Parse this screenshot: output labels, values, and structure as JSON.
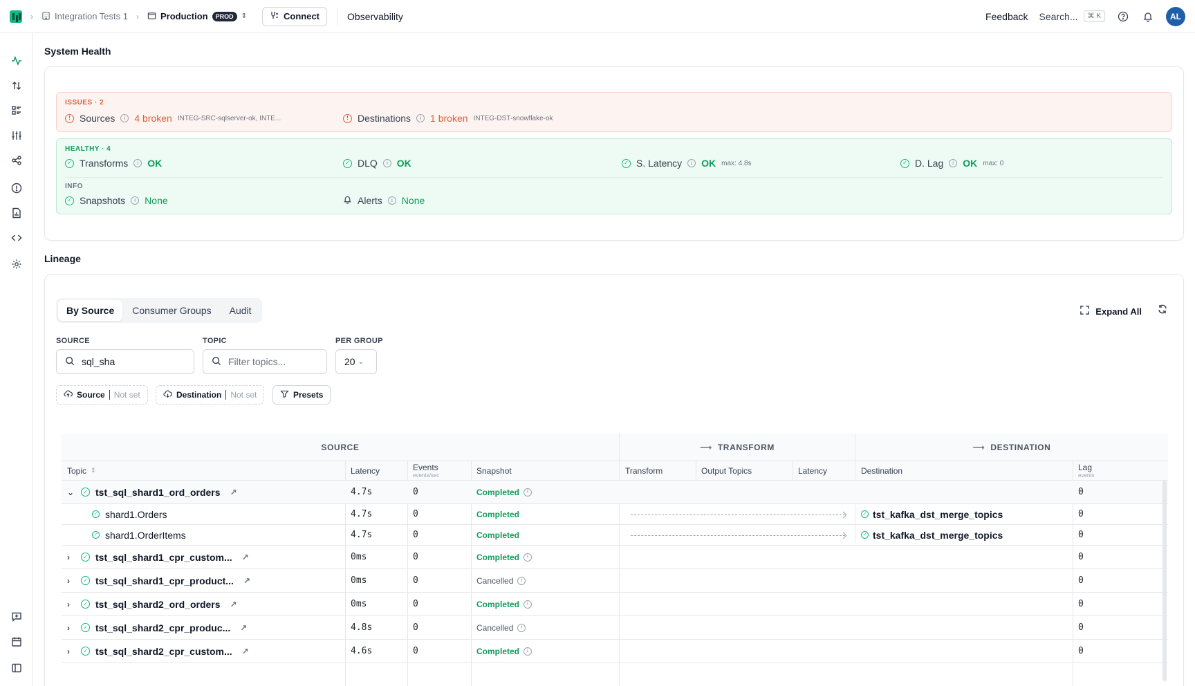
{
  "topbar": {
    "workspace": "Integration Tests 1",
    "environment": "Production",
    "env_badge": "PROD",
    "connect_label": "Connect",
    "page_title": "Observability",
    "feedback_label": "Feedback",
    "search_label": "Search...",
    "search_shortcut": "⌘ K",
    "avatar_initials": "AL"
  },
  "system_health": {
    "title": "System Health",
    "issues_label": "ISSUES · 2",
    "healthy_label": "HEALTHY · 4",
    "info_label": "INFO",
    "issues": [
      {
        "name": "Sources",
        "value": "4 broken",
        "detail": "INTEG-SRC-sqlserver-ok, INTE..."
      },
      {
        "name": "Destinations",
        "value": "1 broken",
        "detail": "INTEG-DST-snowflake-ok"
      }
    ],
    "healthy": [
      {
        "name": "Transforms",
        "value": "OK",
        "detail": ""
      },
      {
        "name": "DLQ",
        "value": "OK",
        "detail": ""
      },
      {
        "name": "S. Latency",
        "value": "OK",
        "detail": "max: 4.8s"
      },
      {
        "name": "D. Lag",
        "value": "OK",
        "detail": "max: 0"
      }
    ],
    "info": [
      {
        "name": "Snapshots",
        "value": "None"
      },
      {
        "name": "Alerts",
        "value": "None"
      }
    ]
  },
  "lineage": {
    "title": "Lineage",
    "tabs": [
      "By Source",
      "Consumer Groups",
      "Audit"
    ],
    "expand_all_label": "Expand All",
    "filters": {
      "source_label": "SOURCE",
      "source_value": "sql_sha",
      "topic_label": "TOPIC",
      "topic_placeholder": "Filter topics...",
      "per_group_label": "PER GROUP",
      "per_group_value": "20"
    },
    "chips": {
      "source_label": "Source",
      "source_value": "Not set",
      "destination_label": "Destination",
      "destination_value": "Not set",
      "presets_label": "Presets"
    },
    "table": {
      "groups": {
        "source": "SOURCE",
        "transform": "TRANSFORM",
        "destination": "DESTINATION"
      },
      "columns": {
        "topic": "Topic",
        "latency": "Latency",
        "events": "Events",
        "events_sub": "events/sec",
        "snapshot": "Snapshot",
        "transform": "Transform",
        "output_topics": "Output Topics",
        "t_latency": "Latency",
        "destination": "Destination",
        "lag": "Lag",
        "lag_sub": "events"
      },
      "rows": [
        {
          "topic": "tst_sql_shard1_ord_orders",
          "latency": "4.7s",
          "events": "0",
          "snapshot": "Completed",
          "lag": "0"
        },
        {
          "topic": "shard1.Orders",
          "latency": "4.7s",
          "events": "0",
          "snapshot": "Completed",
          "destination": "tst_kafka_dst_merge_topics",
          "lag": "0"
        },
        {
          "topic": "shard1.OrderItems",
          "latency": "4.7s",
          "events": "0",
          "snapshot": "Completed",
          "destination": "tst_kafka_dst_merge_topics",
          "lag": "0"
        },
        {
          "topic": "tst_sql_shard1_cpr_custom...",
          "latency": "0ms",
          "events": "0",
          "snapshot": "Completed",
          "lag": "0"
        },
        {
          "topic": "tst_sql_shard1_cpr_product...",
          "latency": "0ms",
          "events": "0",
          "snapshot": "Cancelled",
          "lag": "0"
        },
        {
          "topic": "tst_sql_shard2_ord_orders",
          "latency": "0ms",
          "events": "0",
          "snapshot": "Completed",
          "lag": "0"
        },
        {
          "topic": "tst_sql_shard2_cpr_produc...",
          "latency": "4.8s",
          "events": "0",
          "snapshot": "Cancelled",
          "lag": "0"
        },
        {
          "topic": "tst_sql_shard2_cpr_custom...",
          "latency": "4.6s",
          "events": "0",
          "snapshot": "Completed",
          "lag": "0"
        }
      ]
    }
  }
}
